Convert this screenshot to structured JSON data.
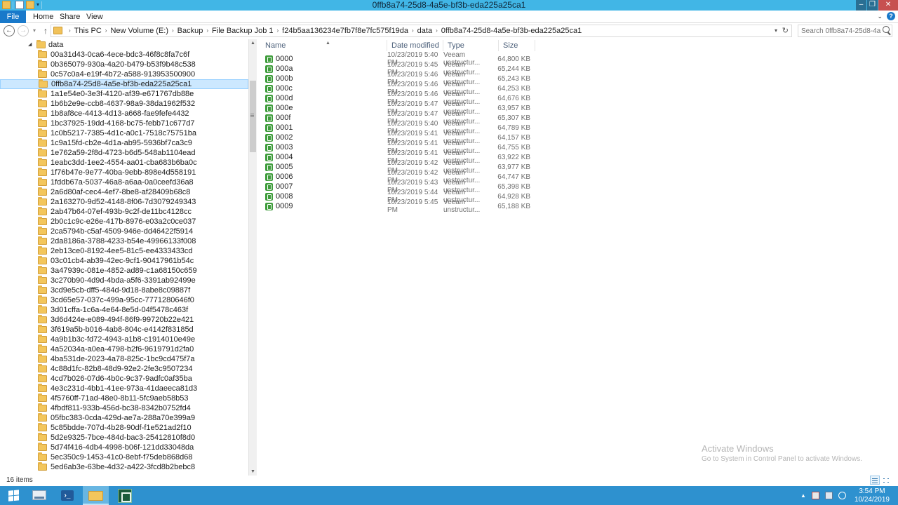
{
  "window": {
    "title": "0ffb8a74-25d8-4a5e-bf3b-eda225a25ca1",
    "minimize": "–",
    "maximize": "❐",
    "close": "✕"
  },
  "ribbon": {
    "tabs": [
      "File",
      "Home",
      "Share",
      "View"
    ],
    "help": "?"
  },
  "address": {
    "crumbs": [
      "This PC",
      "New Volume (E:)",
      "Backup",
      "File Backup Job 1",
      "f24b5aa136234e7fb7f8e7fc575f19da",
      "data",
      "0ffb8a74-25d8-4a5e-bf3b-eda225a25ca1"
    ],
    "search_placeholder": "Search 0ffb8a74-25d8-4a5e-bf..."
  },
  "navpane": {
    "root": "data",
    "selected_index": 3,
    "items": [
      "00a31d43-0ca6-4ece-bdc3-46f8c8fa7c6f",
      "0b365079-930a-4a20-b479-b53f9b48c538",
      "0c57c0a4-e19f-4b72-a588-913953500900",
      "0ffb8a74-25d8-4a5e-bf3b-eda225a25ca1",
      "1a1e54e0-3e3f-4120-af39-e671767db88e",
      "1b6b2e9e-ccb8-4637-98a9-38da1962f532",
      "1b8af8ce-4413-4d13-a668-fae9fefe4432",
      "1bc37925-19dd-4168-bc75-febb71c677d7",
      "1c0b5217-7385-4d1c-a0c1-7518c75751ba",
      "1c9a15fd-cb2e-4d1a-ab95-5936bf7ca3c9",
      "1e762a59-2f8d-4723-b6d5-548ab1104ead",
      "1eabc3dd-1ee2-4554-aa01-cba683b6ba0c",
      "1f76b47e-9e77-40ba-9ebb-898e4d558191",
      "1fddb67a-5037-46a8-a6aa-0a0ceefd36a8",
      "2a6d80af-cec4-4ef7-8be8-af28409b68c8",
      "2a163270-9d52-4148-8f06-7d3079249343",
      "2ab47b64-07ef-493b-9c2f-de11bc4128cc",
      "2b0c1c9c-e26e-417b-8976-e03a2c0ce037",
      "2ca5794b-c5af-4509-946e-dd46422f5914",
      "2da8186a-3788-4233-b54e-49966133f008",
      "2eb13ce0-8192-4ee5-81c5-ee4333433cd",
      "03c01cb4-ab39-42ec-9cf1-90417961b54c",
      "3a47939c-081e-4852-ad89-c1a68150c659",
      "3c270b90-4d9d-4bda-a5f6-3391ab92499e",
      "3cd9e5cb-dff5-484d-9d18-8abe8c09887f",
      "3cd65e57-037c-499a-95cc-7771280646f0",
      "3d01cffa-1c6a-4e64-8e5d-04f5478c463f",
      "3d6d424e-e089-494f-86f9-99720b22e421",
      "3f619a5b-b016-4ab8-804c-e4142f83185d",
      "4a9b1b3c-fd72-4943-a1b8-c1914010e49e",
      "4a52034a-a0ea-4798-b2f6-9619791d2fa0",
      "4ba531de-2023-4a78-825c-1bc9cd475f7a",
      "4c88d1fc-82b8-48d9-92e2-2fe3c9507234",
      "4cd7b026-07d6-4b0c-9c37-9adfc0af35ba",
      "4e3c231d-4bb1-41ee-973a-41daeeca81d3",
      "4f5760ff-71ad-48e0-8b11-5fc9aeb58b53",
      "4fbdf811-933b-456d-bc38-8342b0752fd4",
      "05fbc383-0cda-429d-ae7a-288a70e399a9",
      "5c85bdde-707d-4b28-90df-f1e521ad2f10",
      "5d2e9325-7bce-484d-bac3-25412810f8d0",
      "5d74f416-4db4-4998-b06f-121dd33048da",
      "5ec350c9-1453-41c0-8ebf-f75deb868d68",
      "5ed6ab3e-63be-4d32-a422-3fcd8b2bebc8"
    ]
  },
  "filelist": {
    "columns": {
      "name": "Name",
      "date": "Date modified",
      "type": "Type",
      "size": "Size"
    },
    "files": [
      {
        "name": "0000",
        "date": "10/23/2019 5:40 PM",
        "type": "Veeam unstructur...",
        "size": "64,800 KB"
      },
      {
        "name": "000a",
        "date": "10/23/2019 5:45 PM",
        "type": "Veeam unstructur...",
        "size": "65,244 KB"
      },
      {
        "name": "000b",
        "date": "10/23/2019 5:46 PM",
        "type": "Veeam unstructur...",
        "size": "65,243 KB"
      },
      {
        "name": "000c",
        "date": "10/23/2019 5:46 PM",
        "type": "Veeam unstructur...",
        "size": "64,253 KB"
      },
      {
        "name": "000d",
        "date": "10/23/2019 5:46 PM",
        "type": "Veeam unstructur...",
        "size": "64,676 KB"
      },
      {
        "name": "000e",
        "date": "10/23/2019 5:47 PM",
        "type": "Veeam unstructur...",
        "size": "63,957 KB"
      },
      {
        "name": "000f",
        "date": "10/23/2019 5:47 PM",
        "type": "Veeam unstructur...",
        "size": "65,307 KB"
      },
      {
        "name": "0001",
        "date": "10/23/2019 5:40 PM",
        "type": "Veeam unstructur...",
        "size": "64,789 KB"
      },
      {
        "name": "0002",
        "date": "10/23/2019 5:41 PM",
        "type": "Veeam unstructur...",
        "size": "64,157 KB"
      },
      {
        "name": "0003",
        "date": "10/23/2019 5:41 PM",
        "type": "Veeam unstructur...",
        "size": "64,755 KB"
      },
      {
        "name": "0004",
        "date": "10/23/2019 5:41 PM",
        "type": "Veeam unstructur...",
        "size": "63,922 KB"
      },
      {
        "name": "0005",
        "date": "10/23/2019 5:42 PM",
        "type": "Veeam unstructur...",
        "size": "63,977 KB"
      },
      {
        "name": "0006",
        "date": "10/23/2019 5:42 PM",
        "type": "Veeam unstructur...",
        "size": "64,747 KB"
      },
      {
        "name": "0007",
        "date": "10/23/2019 5:43 PM",
        "type": "Veeam unstructur...",
        "size": "65,398 KB"
      },
      {
        "name": "0008",
        "date": "10/23/2019 5:44 PM",
        "type": "Veeam unstructur...",
        "size": "64,928 KB"
      },
      {
        "name": "0009",
        "date": "10/23/2019 5:45 PM",
        "type": "Veeam unstructur...",
        "size": "65,188 KB"
      }
    ]
  },
  "watermark": {
    "line1": "Activate Windows",
    "line2": "Go to System in Control Panel to activate Windows."
  },
  "status": {
    "count": "16 items"
  },
  "taskbar": {
    "clock_time": "3:54 PM",
    "clock_date": "10/24/2019",
    "ps_label": "›_"
  },
  "colors": {
    "titlebar": "#41b6e6",
    "file_tab": "#1979ca",
    "selection": "#cce8ff",
    "taskbar": "#2e91cf",
    "veeam_icon": "#3e9c3b"
  },
  "icons": [
    "folder-icon",
    "veeam-file-icon",
    "search-icon",
    "back-arrow-icon",
    "forward-arrow-icon",
    "up-arrow-icon",
    "refresh-icon",
    "start-icon",
    "powershell-icon",
    "explorer-icon",
    "veeam-console-icon",
    "server-manager-icon"
  ]
}
